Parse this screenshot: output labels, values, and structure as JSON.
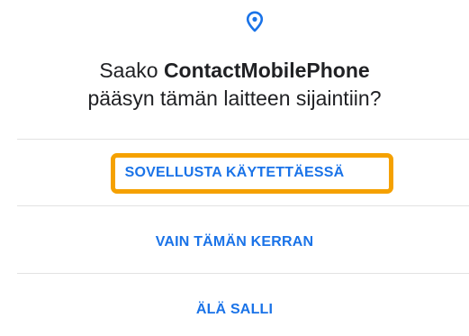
{
  "dialog": {
    "icon": "location-pin-icon",
    "title_prefix": "Saako ",
    "app_name": "ContactMobilePhone",
    "title_line2": "pääsyn tämän laitteen sijaintiin?",
    "accent_color": "#1a73e8",
    "highlight_color": "#f5a100"
  },
  "options": {
    "while_using": "SOVELLUSTA KÄYTETTÄESSÄ",
    "only_this_time": "VAIN TÄMÄN KERRAN",
    "deny": "ÄLÄ SALLI"
  }
}
